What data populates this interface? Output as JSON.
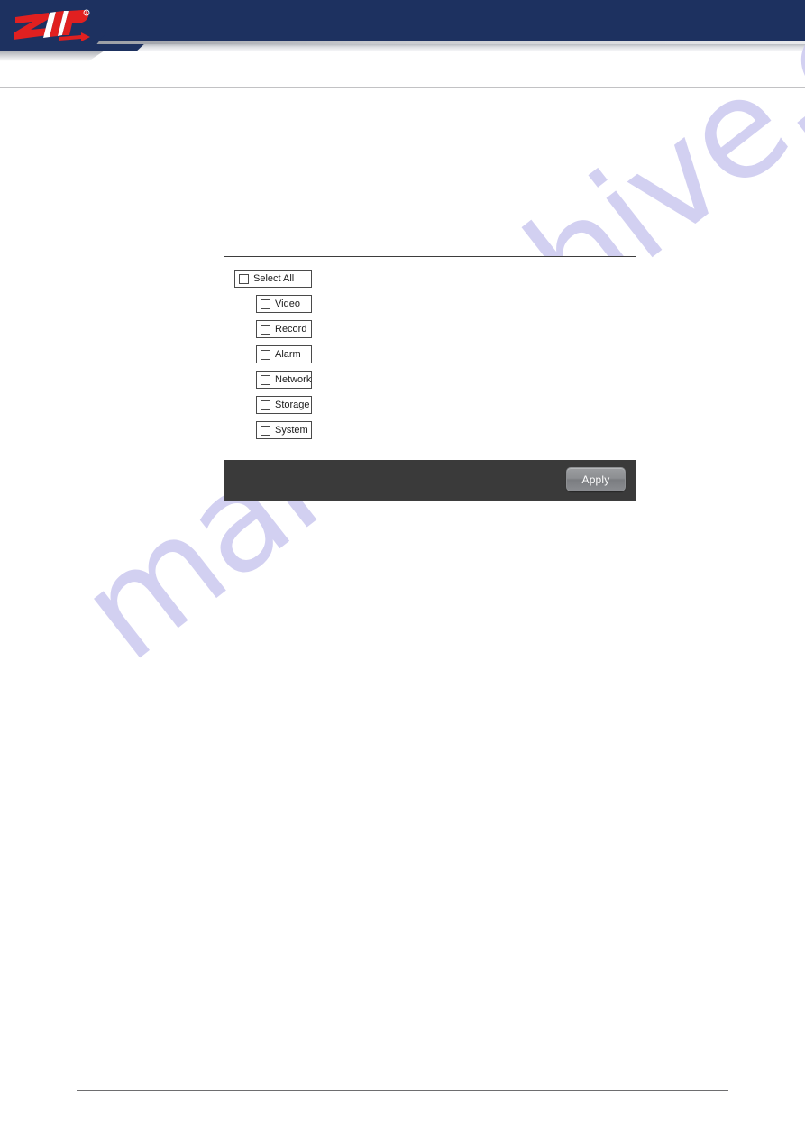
{
  "page": {
    "background_color": "#ffffff",
    "watermark_text": "manualshive.com",
    "watermark_color": "#c9c6ee"
  },
  "header": {
    "logo_text": "ZIP",
    "logo_registered_mark": "®",
    "navy_color": "#1d3160",
    "logo_red": "#e02020",
    "logo_white": "#ffffff"
  },
  "dialog": {
    "body_background": "#ffffff",
    "footer_background": "#3a3a3a",
    "border_color": "#3d3d3d",
    "items": [
      {
        "label": "Select All",
        "checked": false,
        "level": "root"
      },
      {
        "label": "Video",
        "checked": false,
        "level": "child"
      },
      {
        "label": "Record",
        "checked": false,
        "level": "child"
      },
      {
        "label": "Alarm",
        "checked": false,
        "level": "child"
      },
      {
        "label": "Network",
        "checked": false,
        "level": "child"
      },
      {
        "label": "Storage",
        "checked": false,
        "level": "child"
      },
      {
        "label": "System",
        "checked": false,
        "level": "child"
      }
    ],
    "footer": {
      "apply_label": "Apply"
    }
  }
}
